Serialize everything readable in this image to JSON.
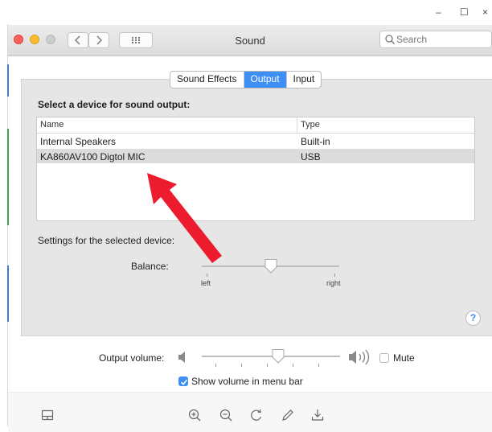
{
  "window_controls": {
    "minimize": "–",
    "maximize": "☐",
    "close": "×"
  },
  "titlebar": {
    "title": "Sound",
    "back_icon": "chevron-left",
    "forward_icon": "chevron-right",
    "grid_icon": "show-all-grid",
    "search": {
      "value": "",
      "placeholder": "Search"
    }
  },
  "tabs": [
    {
      "label": "Sound Effects",
      "active": false
    },
    {
      "label": "Output",
      "active": true
    },
    {
      "label": "Input",
      "active": false
    }
  ],
  "output": {
    "heading": "Select a device for sound output:",
    "columns": [
      "Name",
      "Type"
    ],
    "devices": [
      {
        "name": "Internal Speakers",
        "type": "Built-in",
        "selected": false
      },
      {
        "name": "KA860AV100 Digtol MIC",
        "type": "USB",
        "selected": true
      }
    ],
    "settings_label": "Settings for the selected device:",
    "balance": {
      "label": "Balance:",
      "left": "left",
      "right": "right",
      "value": 0.5
    }
  },
  "help_label": "?",
  "volume": {
    "label": "Output volume:",
    "value": 0.55,
    "mute_label": "Mute",
    "muted": false
  },
  "show_volume": {
    "label": "Show volume in menu bar",
    "checked": true
  },
  "toolbar_icons": [
    "sidebar-icon",
    "zoom-in-icon",
    "zoom-out-icon",
    "rotate-icon",
    "pen-icon",
    "download-icon"
  ],
  "colors": {
    "accent": "#3d8ef5",
    "arrow": "#ec1c2e",
    "pane_bg": "#e6e6e6",
    "selected_row": "#dcdcdc"
  }
}
